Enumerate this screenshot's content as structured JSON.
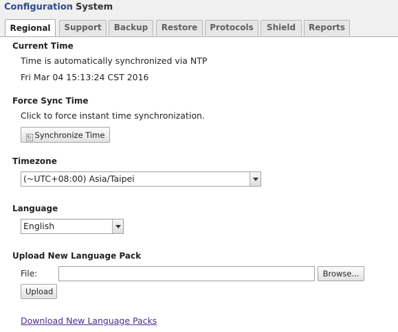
{
  "breadcrumb": {
    "section": "Configuration",
    "separator": "▸",
    "page": "System"
  },
  "tabs": [
    "Regional",
    "Support",
    "Backup",
    "Restore",
    "Protocols",
    "Shield",
    "Reports"
  ],
  "active_tab": "Regional",
  "current_time": {
    "heading": "Current Time",
    "ntp_text": "Time is automatically synchronized via NTP",
    "datetime": "Fri Mar 04 15:13:24 CST 2016"
  },
  "force_sync": {
    "heading": "Force Sync Time",
    "description": "Click to force instant time synchronization.",
    "button_label": "Synchronize Time"
  },
  "timezone": {
    "heading": "Timezone",
    "selected": "(~UTC+08:00) Asia/Taipei"
  },
  "language": {
    "heading": "Language",
    "selected": "English"
  },
  "upload": {
    "heading": "Upload New Language Pack",
    "file_label": "File:",
    "file_value": "",
    "browse_label": "Browse...",
    "upload_label": "Upload"
  },
  "download_link": "Download New Language Packs"
}
